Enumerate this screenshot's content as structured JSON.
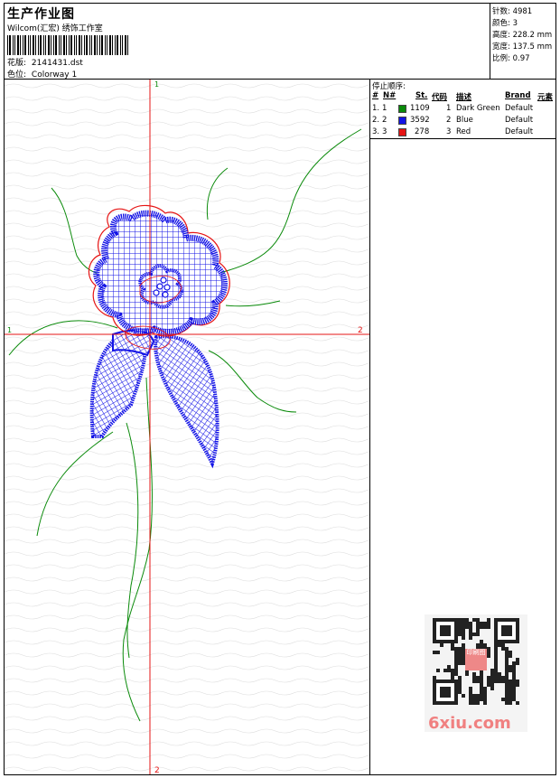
{
  "header": {
    "title": "生产作业图",
    "subtitle": "Wilcom(汇宏) 绣饰工作室",
    "design_label": "花版:",
    "design_file": "2141431.dst",
    "colorway_label": "色位:",
    "colorway": "Colorway 1"
  },
  "stats": [
    {
      "label": "针数:",
      "value": "4981"
    },
    {
      "label": "颜色:",
      "value": "3"
    },
    {
      "label": "高度:",
      "value": "228.2 mm"
    },
    {
      "label": "宽度:",
      "value": "137.5 mm"
    },
    {
      "label": "比例:",
      "value": "0.97"
    }
  ],
  "stop_sequence": {
    "title": "停止顺序:",
    "columns": [
      "#",
      "N#",
      "St.",
      "代码",
      "描述",
      "Brand",
      "元素"
    ],
    "rows": [
      {
        "num": "1.",
        "n": "1",
        "color": "#0a8a0a",
        "stitches": "1109",
        "code": "1",
        "desc": "Dark Green",
        "brand": "Default"
      },
      {
        "num": "2.",
        "n": "2",
        "color": "#1414e6",
        "stitches": "3592",
        "code": "2",
        "desc": "Blue",
        "brand": "Default"
      },
      {
        "num": "3.",
        "n": "3",
        "color": "#e61414",
        "stitches": "278",
        "code": "3",
        "desc": "Red",
        "brand": "Default"
      }
    ]
  },
  "axes": {
    "top_label": "1",
    "bottom_label": "2",
    "left_label": "1",
    "right_label": "2"
  },
  "watermark": {
    "text": "6xiu.com",
    "seal_text": "印刷图"
  },
  "colors": {
    "green": "#0a8a0a",
    "blue": "#1414e6",
    "red": "#e61414"
  }
}
